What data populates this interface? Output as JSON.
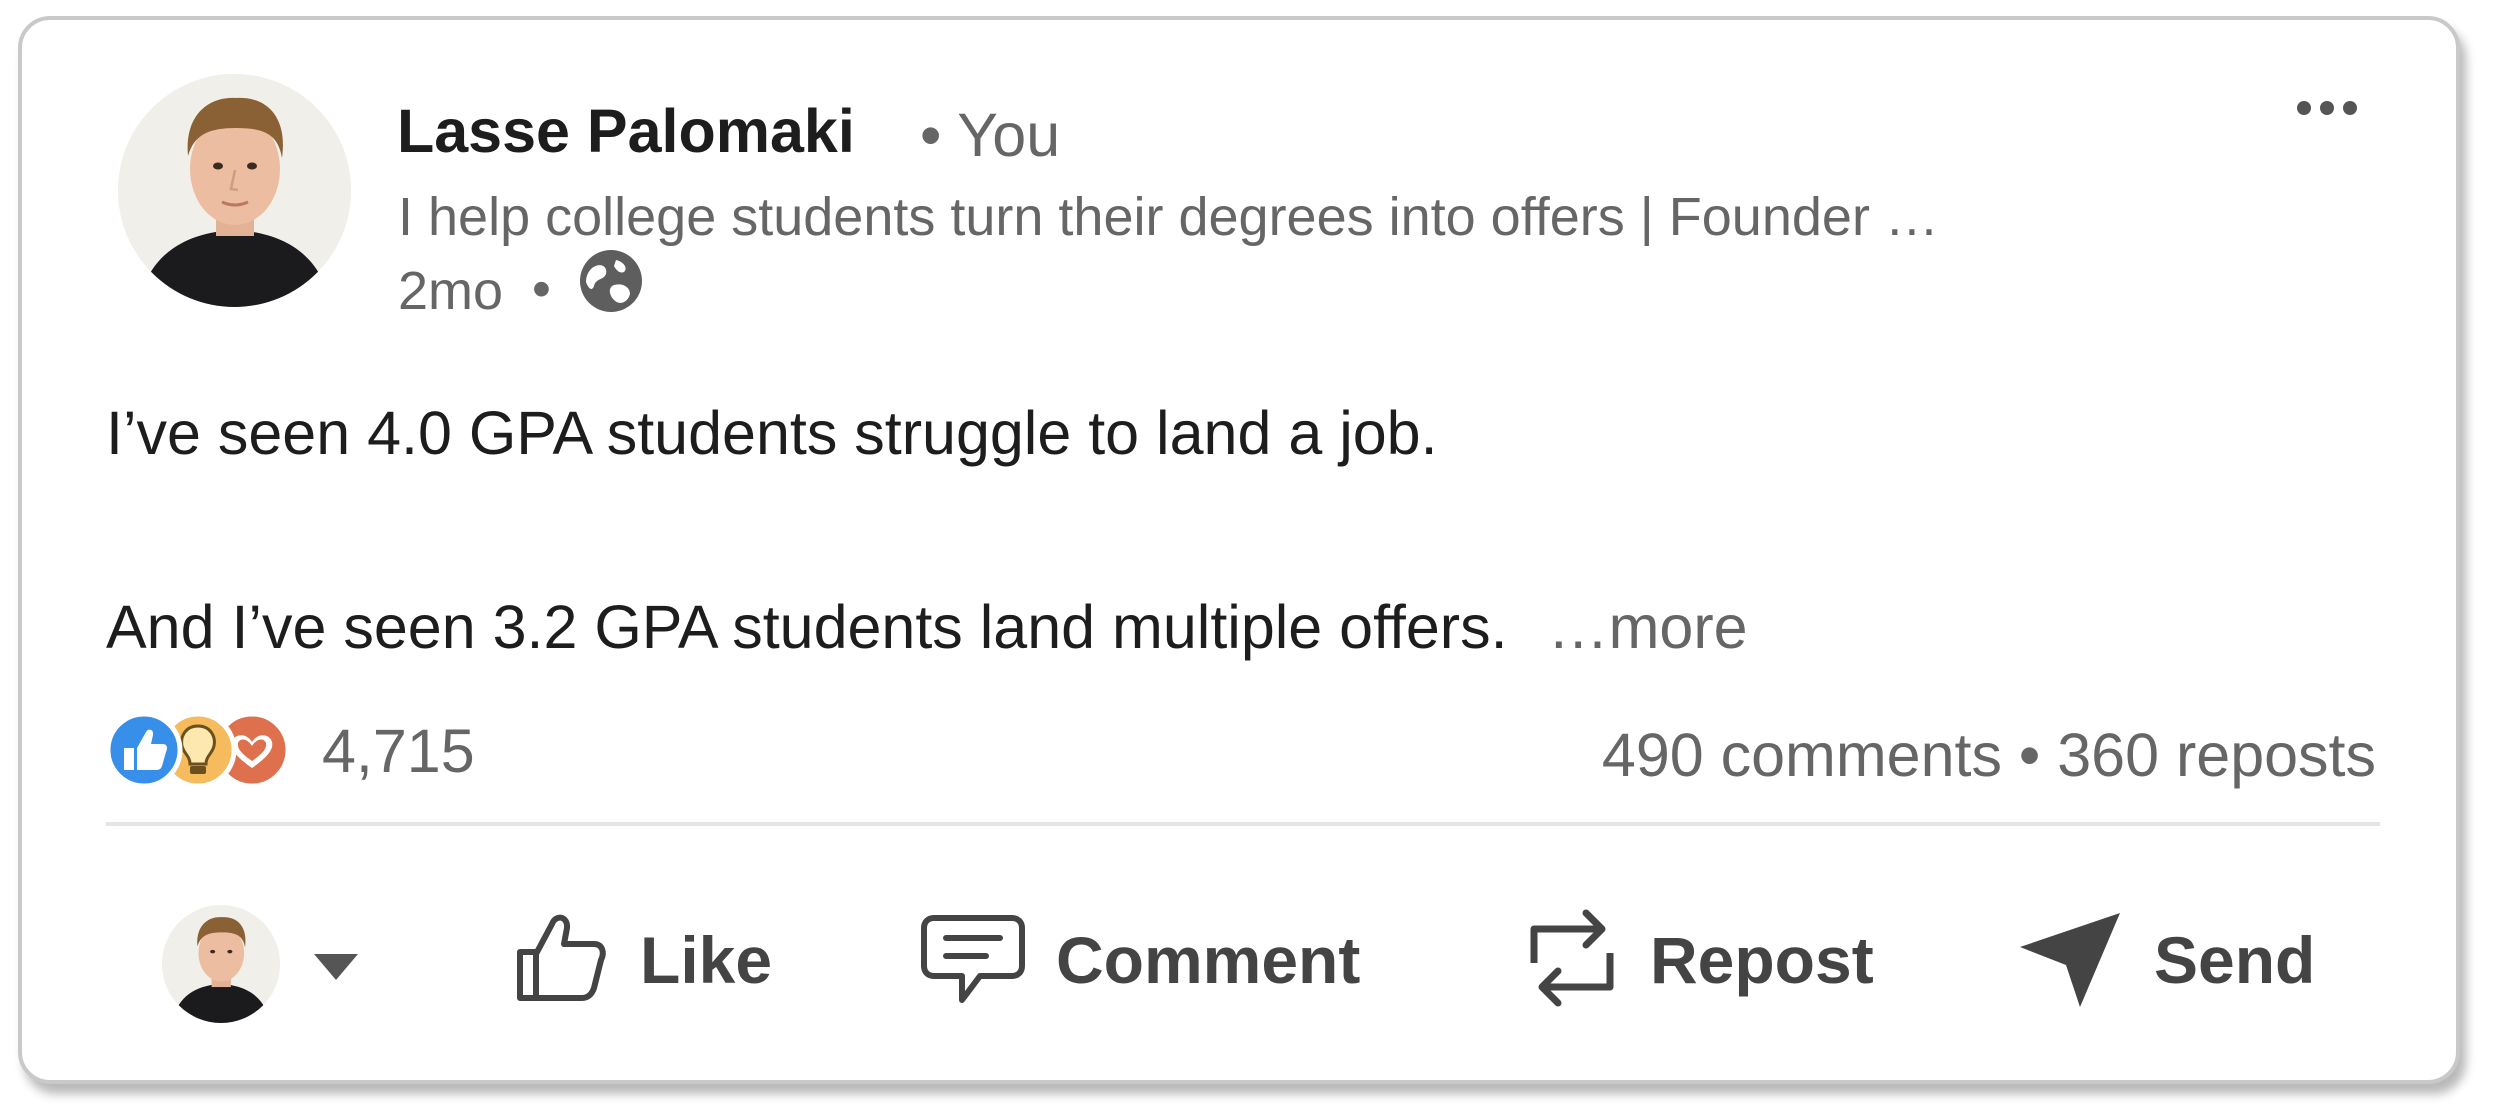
{
  "post": {
    "author_name": "Lasse Palomaki",
    "author_relation": "• You",
    "headline": "I help college students turn their degrees into offers | Founder …",
    "time": "2mo",
    "time_sep": "•",
    "visibility_icon": "globe-icon",
    "body_line_1": "I’ve seen 4.0 GPA students struggle to land a job.",
    "body_line_2": "And I’ve seen 3.2 GPA students land multiple offers.",
    "more_label": "…more"
  },
  "social": {
    "reaction_icons": [
      "like-reaction-icon",
      "insightful-reaction-icon",
      "love-reaction-icon"
    ],
    "reaction_count": "4,715",
    "comments": "490 comments",
    "separator": "•",
    "reposts": "360 reposts"
  },
  "actions": {
    "like_label": "Like",
    "comment_label": "Comment",
    "repost_label": "Repost",
    "send_label": "Send"
  },
  "colors": {
    "like_blue": "#378fe9",
    "insightful_yellow": "#f5bb5c",
    "love_red": "#df704d",
    "text_primary": "#1d1d1d",
    "text_secondary": "#666666",
    "action_text": "#444444"
  }
}
